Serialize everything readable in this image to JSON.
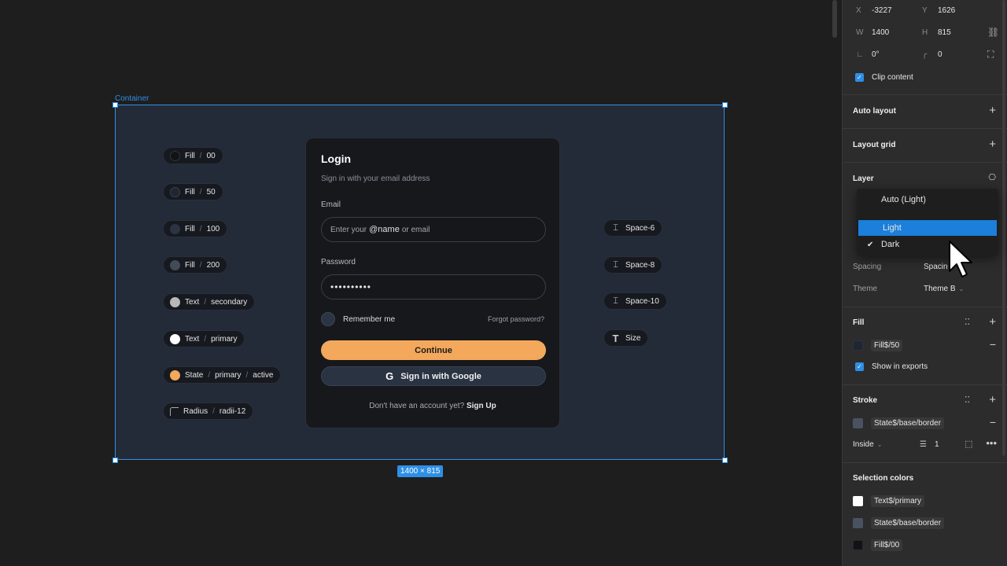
{
  "canvas": {
    "frame_label": "Container",
    "size_badge": "1400 × 815",
    "chips": [
      {
        "a": "Fill",
        "b": "00",
        "color": "#111317"
      },
      {
        "a": "Fill",
        "b": "50",
        "color": "#1f2632"
      },
      {
        "a": "Fill",
        "b": "100",
        "color": "#2d3441"
      },
      {
        "a": "Fill",
        "b": "200",
        "color": "#434b57"
      },
      {
        "a": "Text",
        "b": "secondary",
        "color": "#b8b8b8"
      },
      {
        "a": "Text",
        "b": "primary",
        "color": "#ffffff"
      },
      {
        "a": "State",
        "b": "primary",
        "c": "active",
        "color": "#f3a85c"
      },
      {
        "a": "Radius",
        "b": "radii-12"
      }
    ],
    "spacing_chips": [
      {
        "icon": "space-icon",
        "label": "Space-6"
      },
      {
        "icon": "space-icon",
        "label": "Space-8"
      },
      {
        "icon": "space-icon",
        "label": "Space-10"
      },
      {
        "icon": "text-size-icon",
        "label": "Size"
      }
    ]
  },
  "login": {
    "title": "Login",
    "subtitle": "Sign in with your email address",
    "email_label": "Email",
    "email_placeholder_pre": "Enter your",
    "email_placeholder_bold": "@name",
    "email_placeholder_post": "or email",
    "password_label": "Password",
    "password_value": "••••••••••",
    "remember": "Remember me",
    "forgot": "Forgot password?",
    "continue": "Continue",
    "google": "Sign in with Google",
    "no_account": "Don't have an account yet?",
    "signup": "Sign Up"
  },
  "panel": {
    "x_label": "X",
    "x": "-3227",
    "y_label": "Y",
    "y": "1626",
    "w_label": "W",
    "w": "1400",
    "h_label": "H",
    "h": "815",
    "rotation": "0°",
    "radius": "0",
    "clip_content": "Clip content",
    "auto_layout": "Auto layout",
    "layout_grid": "Layout grid",
    "layer": "Layer",
    "spacing_label": "Spacing",
    "spacing_value": "Spacin",
    "theme_label": "Theme",
    "theme_value": "Theme B",
    "fill": "Fill",
    "fill_token": "Fill$/50",
    "show_exports": "Show in exports",
    "stroke": "Stroke",
    "stroke_token": "State$/base/border",
    "stroke_position": "Inside",
    "stroke_weight": "1",
    "selection_colors": "Selection colors",
    "sel_colors": [
      {
        "token": "Text$/primary",
        "color": "#ffffff"
      },
      {
        "token": "State$/base/border",
        "color": "#4a5160"
      },
      {
        "token": "Fill$/00",
        "color": "#111317"
      }
    ]
  },
  "menu": {
    "items": [
      "Auto (Light)",
      "Light",
      "Dark"
    ],
    "selected": "Light",
    "checked": "Dark"
  }
}
